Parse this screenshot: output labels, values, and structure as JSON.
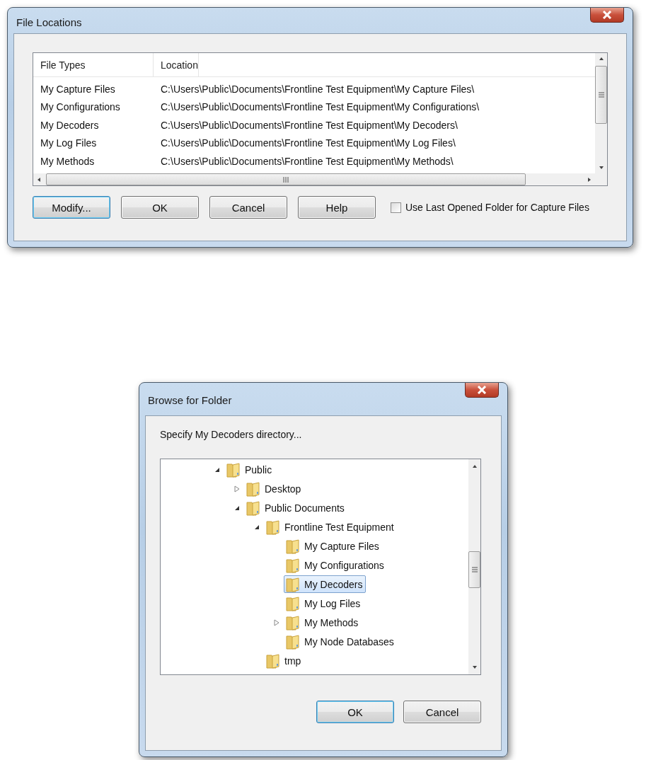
{
  "file_locations_dialog": {
    "title": "File Locations",
    "table": {
      "columns": [
        "File Types",
        "Location"
      ],
      "rows": [
        {
          "cells": [
            "My Capture Files",
            "C:\\Users\\Public\\Documents\\Frontline Test Equipment\\My Capture Files\\"
          ]
        },
        {
          "cells": [
            "My Configurations",
            "C:\\Users\\Public\\Documents\\Frontline Test Equipment\\My Configurations\\"
          ]
        },
        {
          "cells": [
            "My Decoders",
            "C:\\Users\\Public\\Documents\\Frontline Test Equipment\\My Decoders\\"
          ]
        },
        {
          "cells": [
            "My Log Files",
            "C:\\Users\\Public\\Documents\\Frontline Test Equipment\\My Log Files\\"
          ]
        },
        {
          "cells": [
            "My Methods",
            "C:\\Users\\Public\\Documents\\Frontline Test Equipment\\My Methods\\"
          ]
        }
      ]
    },
    "buttons": [
      {
        "label": "Modify...",
        "default": true
      },
      {
        "label": "OK",
        "default": false
      },
      {
        "label": "Cancel",
        "default": false
      },
      {
        "label": "Help",
        "default": false
      }
    ],
    "checkbox": {
      "label": "Use Last Opened Folder for Capture Files",
      "checked": false
    }
  },
  "browse_dialog": {
    "title": "Browse for Folder",
    "prompt": "Specify My Decoders directory...",
    "tree": [
      {
        "label": "Public",
        "kind": "branch",
        "expanded": true,
        "selected": false,
        "children": [
          {
            "label": "Desktop",
            "kind": "branch",
            "expanded": false,
            "selected": false
          },
          {
            "label": "Public Documents",
            "kind": "branch",
            "expanded": true,
            "selected": false,
            "children": [
              {
                "label": "Frontline Test Equipment",
                "kind": "branch",
                "expanded": true,
                "selected": false,
                "children": [
                  {
                    "label": "My Capture Files",
                    "kind": "leaf",
                    "selected": false
                  },
                  {
                    "label": "My Configurations",
                    "kind": "leaf",
                    "selected": false
                  },
                  {
                    "label": "My Decoders",
                    "kind": "leaf",
                    "selected": true
                  },
                  {
                    "label": "My Log Files",
                    "kind": "leaf",
                    "selected": false
                  },
                  {
                    "label": "My Methods",
                    "kind": "branch",
                    "expanded": false,
                    "selected": false
                  },
                  {
                    "label": "My Node Databases",
                    "kind": "leaf",
                    "selected": false
                  }
                ]
              },
              {
                "label": "tmp",
                "kind": "leaf",
                "selected": false
              }
            ]
          }
        ]
      }
    ],
    "buttons": [
      {
        "label": "OK",
        "default": true
      },
      {
        "label": "Cancel",
        "default": false
      }
    ]
  }
}
